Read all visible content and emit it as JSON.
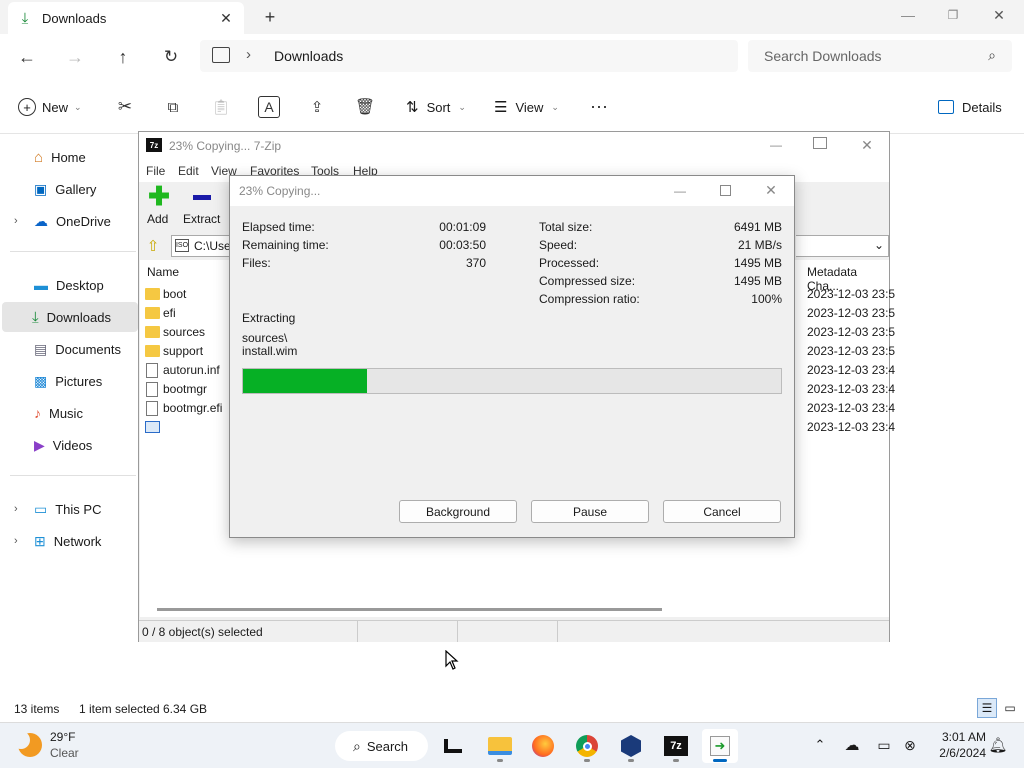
{
  "explorer": {
    "tab_title": "Downloads",
    "address": "Downloads",
    "search_placeholder": "Search Downloads",
    "cmd": {
      "new": "New",
      "sort": "Sort",
      "view": "View",
      "details": "Details"
    },
    "nav": [
      "Home",
      "Gallery",
      "OneDrive",
      "Desktop",
      "Downloads",
      "Documents",
      "Pictures",
      "Music",
      "Videos",
      "This PC",
      "Network"
    ],
    "status": {
      "items": "13 items",
      "selected": "1 item selected",
      "size": "6.34 GB"
    }
  },
  "zip": {
    "title": "23% Copying... 7-Zip",
    "menu": [
      "File",
      "Edit",
      "View",
      "Favorites",
      "Tools",
      "Help"
    ],
    "toolbar": {
      "add": "Add",
      "extract": "Extract"
    },
    "path": "C:\\Use",
    "col_name": "Name",
    "col_meta": "Metadata Cha...",
    "files": [
      "boot",
      "efi",
      "sources",
      "support",
      "autorun.inf",
      "bootmgr",
      "bootmgr.efi",
      ""
    ],
    "dates": [
      "2023-12-03 23:5",
      "2023-12-03 23:5",
      "2023-12-03 23:5",
      "2023-12-03 23:5",
      "2023-12-03 23:4",
      "2023-12-03 23:4",
      "2023-12-03 23:4",
      "2023-12-03 23:4"
    ],
    "status": "0 / 8 object(s) selected"
  },
  "dialog": {
    "title": "23% Copying...",
    "elapsed_label": "Elapsed time:",
    "elapsed": "00:01:09",
    "remaining_label": "Remaining time:",
    "remaining": "00:03:50",
    "files_label": "Files:",
    "files": "370",
    "total_label": "Total size:",
    "total": "6491 MB",
    "speed_label": "Speed:",
    "speed": "21 MB/s",
    "processed_label": "Processed:",
    "processed": "1495 MB",
    "compressed_label": "Compressed size:",
    "compressed": "1495 MB",
    "ratio_label": "Compression ratio:",
    "ratio": "100%",
    "action": "Extracting",
    "path1": "sources\\",
    "path2": "install.wim",
    "progress": 0.23,
    "buttons": {
      "background": "Background",
      "pause": "Pause",
      "cancel": "Cancel"
    }
  },
  "taskbar": {
    "weather_temp": "29°F",
    "weather_desc": "Clear",
    "search": "Search",
    "time": "3:01 AM",
    "date": "2/6/2024"
  },
  "colors": {
    "progress": "#06b025",
    "accent": "#0067c0"
  }
}
